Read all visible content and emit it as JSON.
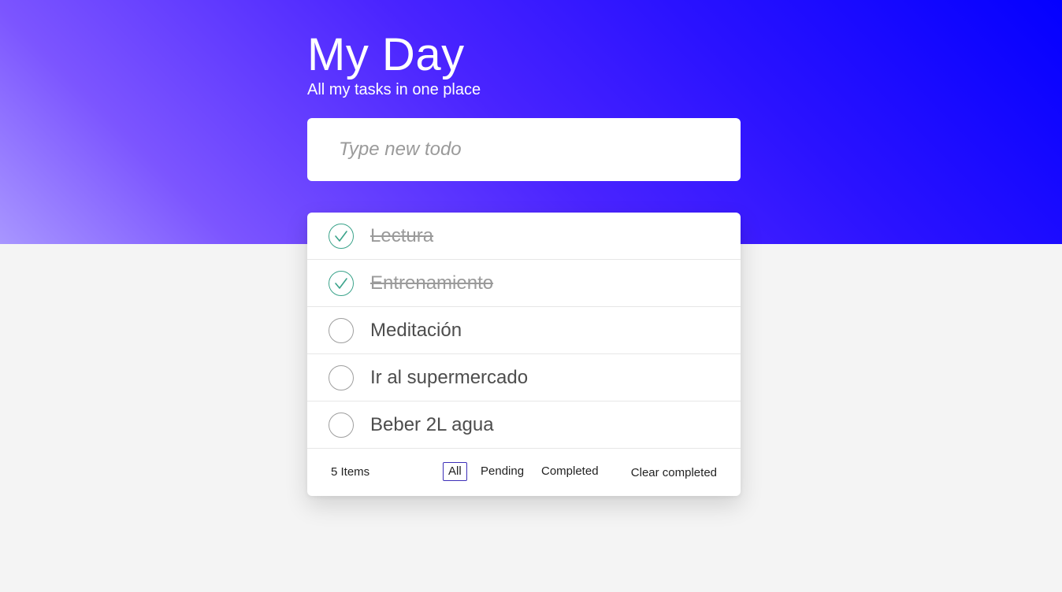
{
  "header": {
    "title": "My Day",
    "subtitle": "All my tasks in one place"
  },
  "new_todo": {
    "placeholder": "Type new todo",
    "value": ""
  },
  "todos": [
    {
      "text": "Lectura",
      "completed": true
    },
    {
      "text": "Entrenamiento",
      "completed": true
    },
    {
      "text": "Meditación",
      "completed": false
    },
    {
      "text": "Ir al supermercado",
      "completed": false
    },
    {
      "text": "Beber 2L agua",
      "completed": false
    }
  ],
  "footer": {
    "count_label": "5 Items",
    "filters": [
      {
        "label": "All",
        "active": true
      },
      {
        "label": "Pending",
        "active": false
      },
      {
        "label": "Completed",
        "active": false
      }
    ],
    "clear_label": "Clear completed"
  },
  "icons": {
    "check": "check-icon"
  },
  "colors": {
    "gradient_start": "#a896ff",
    "gradient_end": "#0400ff",
    "check_done": "#3aa38a",
    "filter_active_border": "#3d2fb8",
    "page_background": "#f4f4f4"
  }
}
